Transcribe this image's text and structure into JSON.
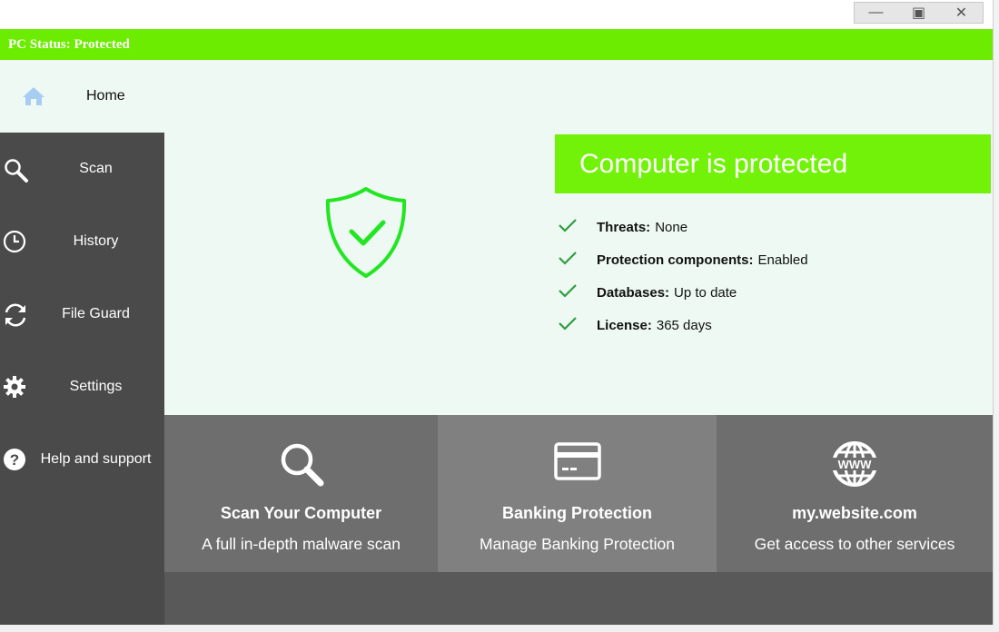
{
  "window": {
    "minimize_glyph": "—",
    "maximize_glyph": "▣",
    "close_glyph": "✕"
  },
  "status_bar": {
    "text": "PC Status: Protected"
  },
  "home": {
    "label": "Home",
    "icon": "home-icon"
  },
  "sidebar": {
    "items": [
      {
        "label": "Scan",
        "icon": "magnifier-icon"
      },
      {
        "label": "History",
        "icon": "clock-icon"
      },
      {
        "label": "File Guard",
        "icon": "sync-icon"
      },
      {
        "label": "Settings",
        "icon": "gear-icon"
      },
      {
        "label": "Help and support",
        "icon": "question-icon"
      }
    ]
  },
  "protection": {
    "banner": "Computer is protected",
    "items": [
      {
        "label": "Threats:",
        "value": "None"
      },
      {
        "label": "Protection components:",
        "value": "Enabled"
      },
      {
        "label": "Databases:",
        "value": "Up to date"
      },
      {
        "label": "License:",
        "value": "365 days"
      }
    ]
  },
  "tiles": [
    {
      "title": "Scan Your Computer",
      "subtitle": "A full in-depth malware scan",
      "icon": "magnifier-icon"
    },
    {
      "title": "Banking Protection",
      "subtitle": "Manage Banking Protection",
      "icon": "credit-card-icon"
    },
    {
      "title": "my.website.com",
      "subtitle": "Get access to other services",
      "icon": "www-globe-icon"
    }
  ],
  "colors": {
    "status_green": "#6cec00",
    "banner_green": "#72f208",
    "shield_green": "#22e622",
    "check_green": "#2e9e3e",
    "sidebar_bg": "#4a4a4a",
    "main_bg": "#eef9f3"
  }
}
